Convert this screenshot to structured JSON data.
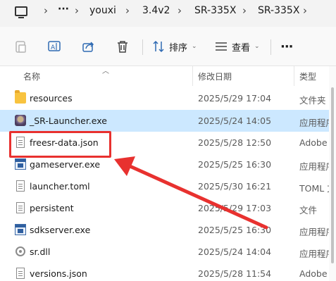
{
  "breadcrumb": {
    "items": [
      "youxi",
      "3.4v2",
      "SR-335X",
      "SR-335X"
    ]
  },
  "toolbar": {
    "sort_label": "排序",
    "view_label": "查看",
    "more_label": "···"
  },
  "columns": {
    "name": "名称",
    "modified": "修改日期",
    "type": "类型"
  },
  "files": [
    {
      "icon": "folder-icon",
      "name": "resources",
      "date": "2025/5/29 17:04",
      "type": "文件夹"
    },
    {
      "icon": "launcher-app-icon",
      "name": "_SR-Launcher.exe",
      "date": "2025/5/24 14:05",
      "type": "应用程序",
      "selected": true
    },
    {
      "icon": "json-file-icon",
      "name": "freesr-data.json",
      "date": "2025/5/28 12:50",
      "type": "Adobe"
    },
    {
      "icon": "exe-app-icon",
      "name": "gameserver.exe",
      "date": "2025/5/25 16:30",
      "type": "应用程序"
    },
    {
      "icon": "toml-file-icon",
      "name": "launcher.toml",
      "date": "2025/5/30 16:21",
      "type": "TOML 文件"
    },
    {
      "icon": "file-icon",
      "name": "persistent",
      "date": "2025/5/29 17:03",
      "type": "文件"
    },
    {
      "icon": "exe-app-icon",
      "name": "sdkserver.exe",
      "date": "2025/5/25 16:30",
      "type": "应用程序"
    },
    {
      "icon": "dll-gear-icon",
      "name": "sr.dll",
      "date": "2025/5/24 14:04",
      "type": "应用程序"
    },
    {
      "icon": "json-file-icon",
      "name": "versions.json",
      "date": "2025/5/28 11:54",
      "type": "Adobe"
    }
  ],
  "colors": {
    "selection": "#cce8ff",
    "annotation": "#e8312f"
  }
}
